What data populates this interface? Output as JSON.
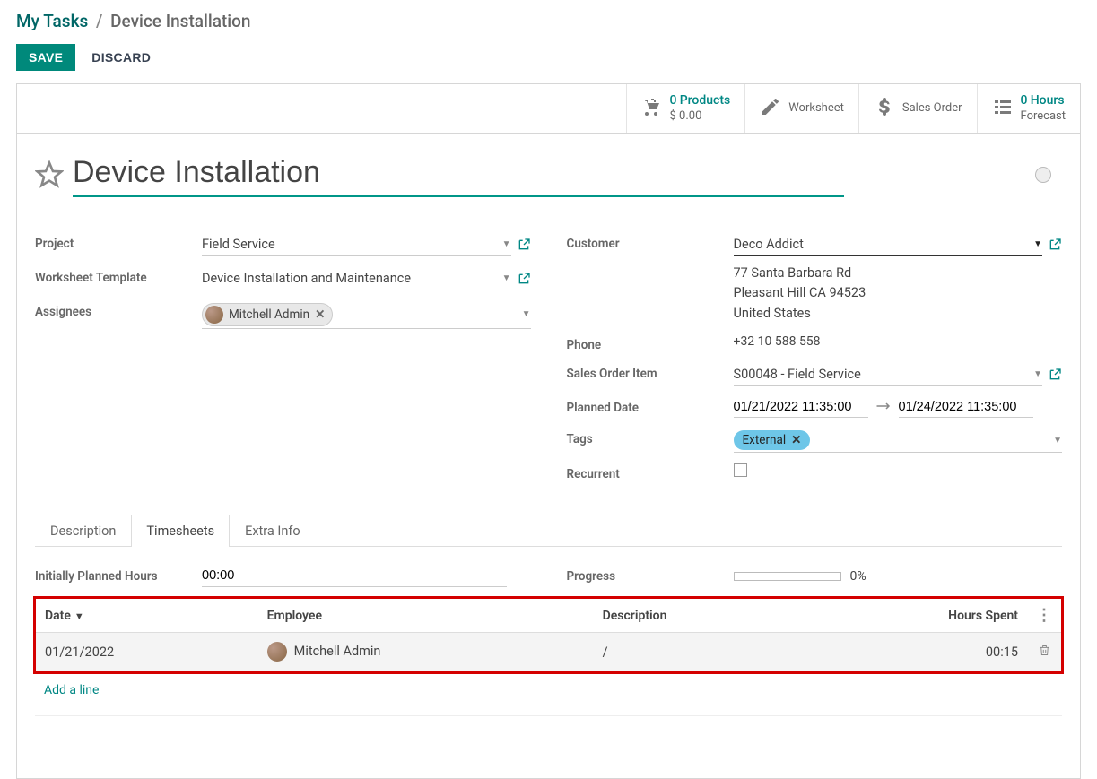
{
  "breadcrumb": {
    "root": "My Tasks",
    "current": "Device Installation"
  },
  "buttons": {
    "save": "SAVE",
    "discard": "DISCARD"
  },
  "statbar": {
    "products": {
      "count": "0",
      "count_suffix": "Products",
      "amount": "$ 0.00"
    },
    "worksheet": "Worksheet",
    "sales_order": "Sales Order",
    "hours": {
      "count": "0",
      "count_suffix": "Hours",
      "sub": "Forecast"
    }
  },
  "title": "Device Installation",
  "fields": {
    "project": {
      "label": "Project",
      "value": "Field Service"
    },
    "worksheet_template": {
      "label": "Worksheet Template",
      "value": "Device Installation and Maintenance"
    },
    "assignees": {
      "label": "Assignees",
      "chip": "Mitchell Admin"
    },
    "customer": {
      "label": "Customer",
      "value": "Deco Addict",
      "address_line1": "77 Santa Barbara Rd",
      "address_line2": "Pleasant Hill CA 94523",
      "address_line3": "United States"
    },
    "phone": {
      "label": "Phone",
      "value": "+32 10 588 558"
    },
    "sales_order_item": {
      "label": "Sales Order Item",
      "value": "S00048 - Field Service"
    },
    "planned_date": {
      "label": "Planned Date",
      "from": "01/21/2022 11:35:00",
      "to": "01/24/2022 11:35:00"
    },
    "tags": {
      "label": "Tags",
      "chip": "External"
    },
    "recurrent": {
      "label": "Recurrent"
    }
  },
  "tabs": {
    "description": "Description",
    "timesheets": "Timesheets",
    "extra": "Extra Info"
  },
  "timesheet": {
    "initially_planned": {
      "label": "Initially Planned Hours",
      "value": "00:00"
    },
    "progress": {
      "label": "Progress",
      "value": "0%"
    },
    "headers": {
      "date": "Date",
      "employee": "Employee",
      "description": "Description",
      "hours": "Hours Spent"
    },
    "rows": [
      {
        "date": "01/21/2022",
        "employee": "Mitchell Admin",
        "description": "/",
        "hours": "00:15"
      }
    ],
    "add_line": "Add a line"
  }
}
